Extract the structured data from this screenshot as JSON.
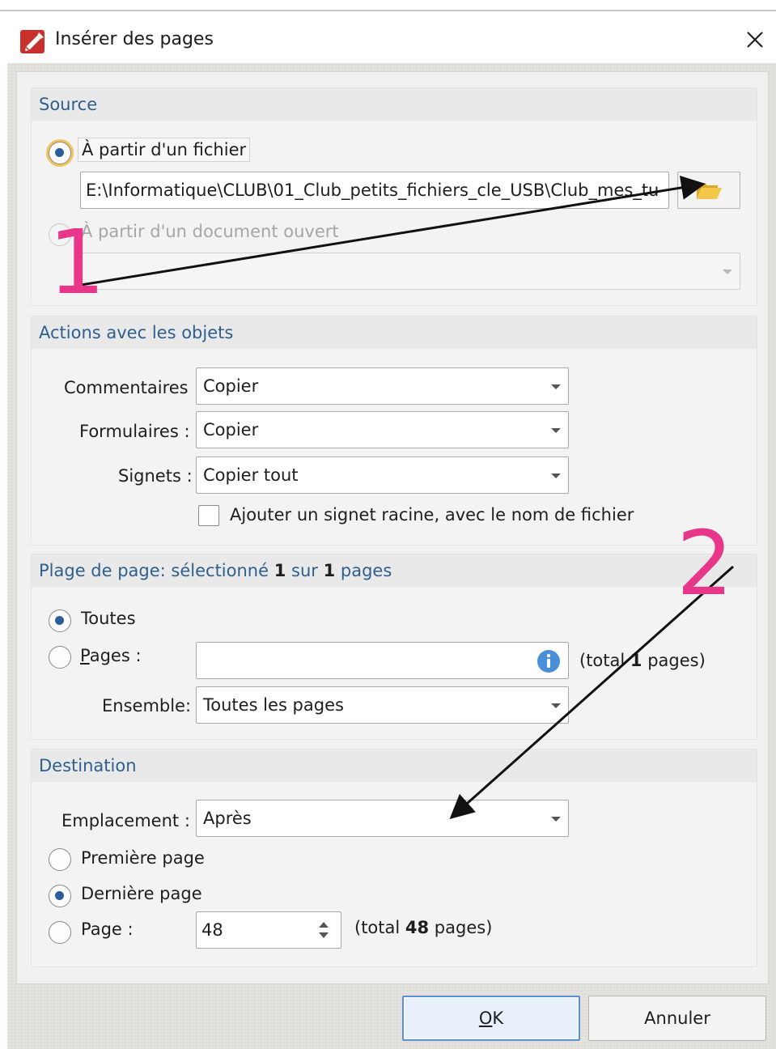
{
  "dialog": {
    "title": "Insérer des pages",
    "close_icon": "close-icon",
    "app_icon": "pdf-editor-icon"
  },
  "source": {
    "title": "Source",
    "from_file_label": "À partir d'un fichier",
    "from_file_selected": true,
    "file_path": "E:\\Informatique\\CLUB\\01_Club_petits_fichiers_cle_USB\\Club_mes_tu",
    "browse_icon": "folder-open-icon",
    "from_open_doc_label": "À partir d'un document ouvert",
    "open_doc_value": ""
  },
  "actions": {
    "title": "Actions avec les objets",
    "comments_label": "Commentaires",
    "comments_value": "Copier",
    "forms_label": "Formulaires :",
    "forms_value": "Copier",
    "bookmarks_label": "Signets :",
    "bookmarks_value": "Copier tout",
    "root_bookmark_label": "Ajouter un signet racine, avec le nom de fichier",
    "root_bookmark_checked": false
  },
  "page_range": {
    "title_prefix": "Plage de page: sélectionné ",
    "selected": "1",
    "title_middle": " sur ",
    "total": "1",
    "title_suffix": " pages",
    "all_label": "Toutes",
    "all_selected": true,
    "pages_label_mnemonic": "P",
    "pages_label_rest": "ages :",
    "pages_value": "",
    "info_icon": "info-icon",
    "pages_total_prefix": "(total ",
    "pages_total_value": "1",
    "pages_total_suffix": " pages)",
    "set_label": "Ensemble:",
    "set_value": "Toutes les pages"
  },
  "destination": {
    "title": "Destination",
    "location_label": "Emplacement :",
    "location_value": "Après",
    "first_page_label": "Première page",
    "last_page_label": "Dernière page",
    "last_page_selected": true,
    "page_label": "Page :",
    "page_value": "48",
    "page_total_prefix": "(total ",
    "page_total_value": "48",
    "page_total_suffix": " pages)"
  },
  "buttons": {
    "ok_mnemonic": "O",
    "ok_rest": "K",
    "cancel_label": "Annuler"
  },
  "annotations": {
    "marker_1": "1",
    "marker_2": "2",
    "marker_color": "#e8368a",
    "arrow_color": "#111111"
  }
}
